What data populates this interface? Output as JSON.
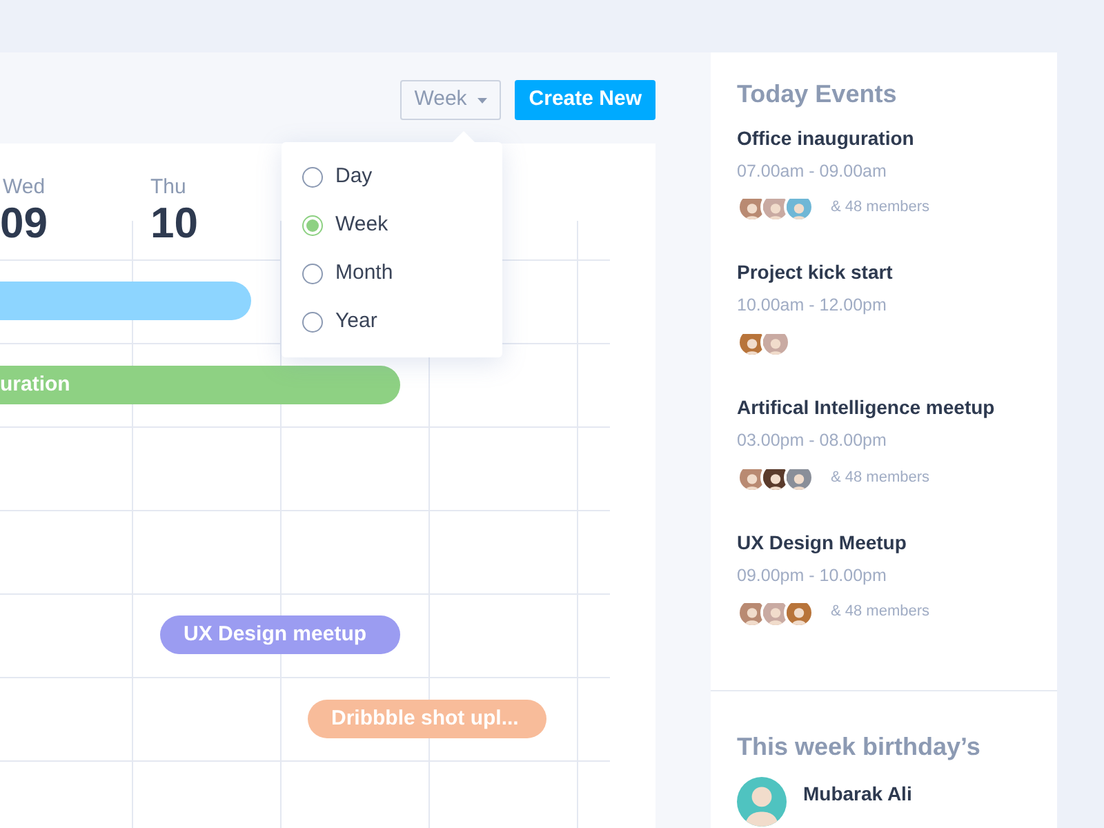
{
  "toolbar": {
    "view_select": {
      "value": "Week",
      "options": [
        {
          "label": "Day",
          "selected": false
        },
        {
          "label": "Week",
          "selected": true
        },
        {
          "label": "Month",
          "selected": false
        },
        {
          "label": "Year",
          "selected": false
        }
      ]
    },
    "create_button": "Create New"
  },
  "calendar": {
    "days": [
      {
        "weekday": "Wed",
        "date": "09"
      },
      {
        "weekday": "Thu",
        "date": "10"
      }
    ],
    "events": [
      {
        "color": "#8dd5ff"
      },
      {
        "title": "uration",
        "color": "#8ed183"
      },
      {
        "title": "UX Design meetup",
        "color": "#9b9cf1"
      },
      {
        "title": "Dribbble shot upl...",
        "color": "#f8bc9a"
      }
    ]
  },
  "today_events": {
    "title": "Today Events",
    "items": [
      {
        "name": "Office inauguration",
        "time": "07.00am - 09.00am",
        "avatars": [
          {
            "color": "#b98a72"
          },
          {
            "color": "#c9aaa2"
          },
          {
            "color": "#6fb7d6"
          }
        ],
        "members": "& 48 members"
      },
      {
        "name": "Project kick start",
        "time": "10.00am - 12.00pm",
        "avatars": [
          {
            "color": "#b8743a"
          },
          {
            "color": "#c9aaa2"
          }
        ]
      },
      {
        "name": "Artifical Intelligence meetup",
        "time": "03.00pm - 08.00pm",
        "avatars": [
          {
            "color": "#b98a72"
          },
          {
            "color": "#5a3b2c"
          },
          {
            "color": "#8a8f99"
          }
        ],
        "members": "& 48 members"
      },
      {
        "name": "UX Design Meetup",
        "time": "09.00pm - 10.00pm",
        "avatars": [
          {
            "color": "#b98a72"
          },
          {
            "color": "#c9aaa2"
          },
          {
            "color": "#b8743a"
          }
        ],
        "members": "& 48 members"
      }
    ]
  },
  "birthdays": {
    "title": "This week birthday’s",
    "people": [
      {
        "name": "Mubarak Ali",
        "avatar": {
          "color": "#4fc3c0"
        }
      }
    ]
  }
}
